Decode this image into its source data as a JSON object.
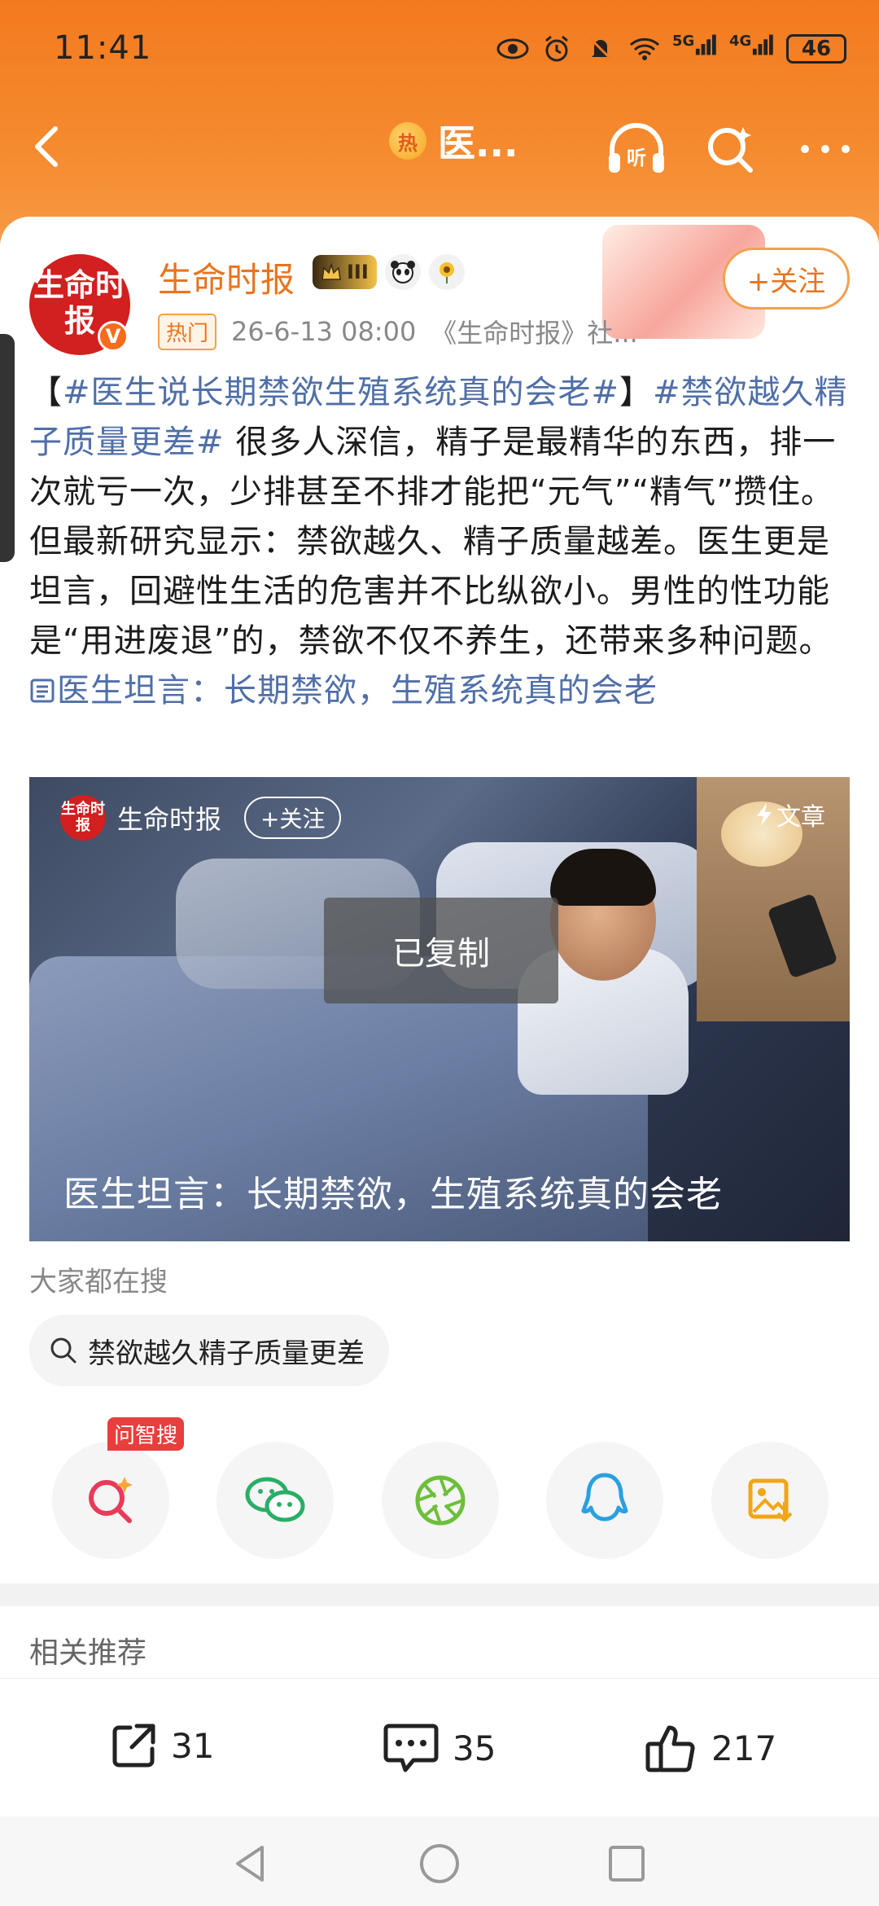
{
  "status_bar": {
    "time": "11:41",
    "network1": "5G",
    "network2": "4G",
    "battery": "46"
  },
  "nav": {
    "hot_icon_text": "热",
    "title": "医..."
  },
  "post": {
    "author": {
      "name": "生命时报",
      "avatar_text": "生命时报",
      "verified_mark": "V",
      "vip_level": "III"
    },
    "hot_tag": "热门",
    "timestamp": "26-6-13 08:00",
    "source": "《生命时报》社...",
    "follow_label": "+关注",
    "text": {
      "bracket_open": "【",
      "hashtag1": "#医生说长期禁欲生殖系统真的会老#",
      "bracket_close": "】",
      "hashtag2": "#禁欲越久精子质量更差#",
      "body": "很多人深信，精子是最精华的东西，排一次就亏一次，少排甚至不排才能把“元气”“精气”攒住。但最新研究显示：禁欲越久、精子质量越差。医生更是坦言，回避性生活的危害并不比纵欲小。男性的性功能是“用进废退”的，禁欲不仅不养生，还带来多种问题。",
      "link": "医生坦言：长期禁欲，生殖系统真的会老"
    }
  },
  "video": {
    "author_name": "生命时报",
    "avatar_text": "生命时报",
    "follow_label": "+关注",
    "article_label": "文章",
    "toast": "已复制",
    "caption": "医生坦言：长期禁欲，生殖系统真的会老"
  },
  "search": {
    "label": "大家都在搜",
    "chip": "禁欲越久精子质量更差"
  },
  "share": {
    "ask_badge": "问智搜"
  },
  "related": {
    "label": "相关推荐"
  },
  "actions": {
    "repost_count": "31",
    "comment_count": "35",
    "like_count": "217"
  },
  "colors": {
    "header_orange": "#f37a1f",
    "accent": "#e8741e",
    "link": "#506fa8"
  }
}
